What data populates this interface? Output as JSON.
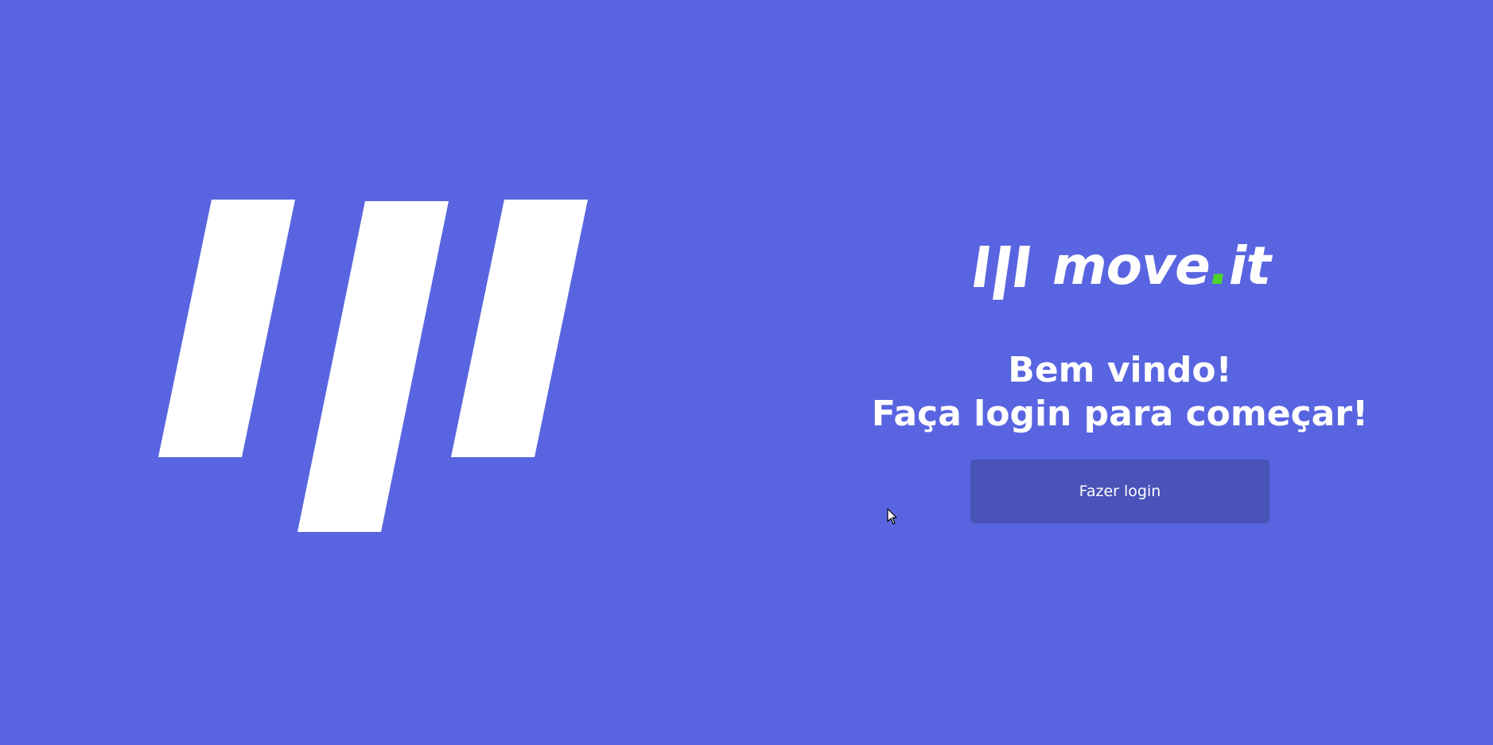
{
  "app": {
    "brand_name": "move",
    "brand_dot": ".",
    "brand_suffix": "it"
  },
  "welcome": {
    "title": "Bem vindo!",
    "subtitle": "Faça login para começar!"
  },
  "login": {
    "button_label": "Fazer login"
  },
  "colors": {
    "background": "#5965e0",
    "button": "#4953b8",
    "accent": "#4cd62b",
    "text": "#ffffff"
  },
  "icons": {
    "hero": "brand-stripes-icon",
    "logo": "brand-stripes-icon",
    "cursor": "mouse-cursor-icon"
  }
}
